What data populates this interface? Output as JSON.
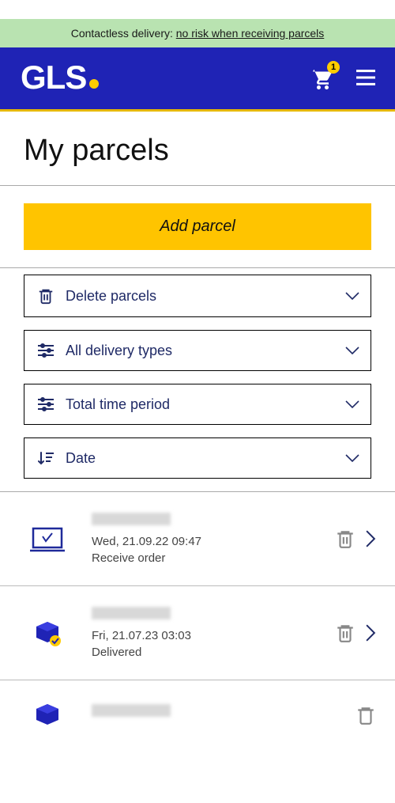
{
  "banner": {
    "prefix": "Contactless delivery: ",
    "link": "no risk when receiving parcels"
  },
  "header": {
    "logo": "GLS",
    "cart_count": "1"
  },
  "page": {
    "title": "My parcels",
    "add_button": "Add parcel"
  },
  "filters": [
    {
      "label": "Delete parcels",
      "icon": "trash"
    },
    {
      "label": "All delivery types",
      "icon": "sliders"
    },
    {
      "label": "Total time period",
      "icon": "sliders"
    },
    {
      "label": "Date",
      "icon": "sort"
    }
  ],
  "parcels": [
    {
      "icon": "monitor",
      "date": "Wed, 21.09.22 09:47",
      "status": "Receive order"
    },
    {
      "icon": "box-check",
      "date": "Fri, 21.07.23 03:03",
      "status": "Delivered"
    },
    {
      "icon": "box",
      "date": "",
      "status": ""
    }
  ]
}
